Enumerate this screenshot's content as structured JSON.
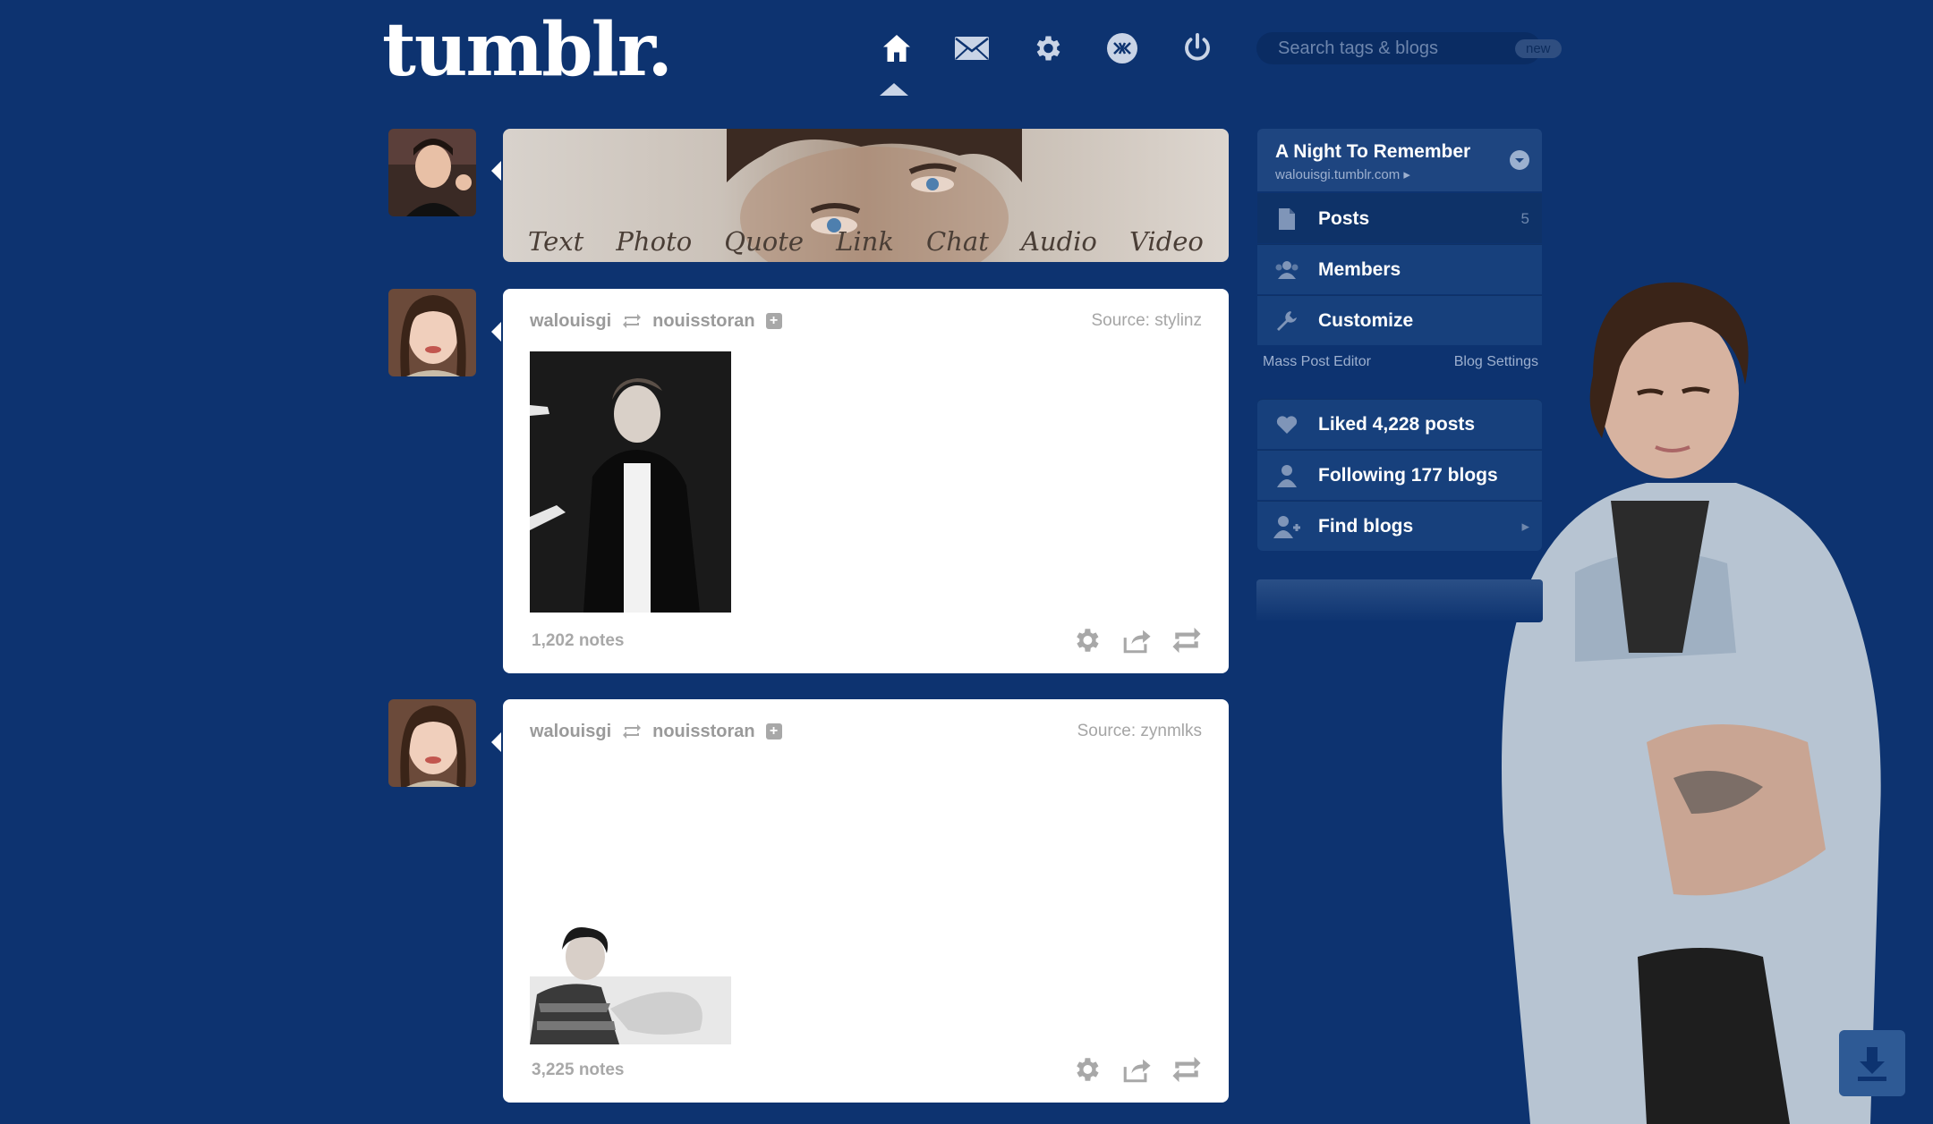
{
  "header": {
    "logo": "tumblr.",
    "nav": [
      {
        "icon": "home-icon"
      },
      {
        "icon": "mail-icon"
      },
      {
        "icon": "gear-icon"
      },
      {
        "icon": "xkit-icon"
      },
      {
        "icon": "power-icon"
      }
    ],
    "search_placeholder": "Search tags & blogs",
    "search_badge": "new"
  },
  "post_box": {
    "types": [
      "Text",
      "Photo",
      "Quote",
      "Link",
      "Chat",
      "Audio",
      "Video"
    ]
  },
  "posts": [
    {
      "author": "walouisgi",
      "reblogged_from": "nouisstoran",
      "source": "Source: stylinz",
      "notes": "1,202 notes"
    },
    {
      "author": "walouisgi",
      "reblogged_from": "nouisstoran",
      "source": "Source: zynmlks",
      "notes": "3,225 notes"
    }
  ],
  "sidebar": {
    "blog_title": "A Night To Remember",
    "blog_url": "walouisgi.tumblr.com",
    "items": [
      {
        "label": "Posts",
        "count": "5",
        "icon": "document-icon"
      },
      {
        "label": "Members",
        "icon": "members-icon"
      },
      {
        "label": "Customize",
        "icon": "wrench-icon"
      }
    ],
    "links": {
      "mass_post_editor": "Mass Post Editor",
      "blog_settings": "Blog Settings"
    },
    "stats": [
      {
        "label": "Liked 4,228 posts",
        "icon": "heart-icon"
      },
      {
        "label": "Following 177 blogs",
        "icon": "person-icon"
      },
      {
        "label": "Find blogs",
        "icon": "add-person-icon"
      }
    ]
  },
  "colors": {
    "background": "#0d3370",
    "sidebar": "#17407c",
    "sidebar_active": "#0e3268",
    "post_bg": "#ffffff",
    "muted_text": "#9a9a9a"
  }
}
